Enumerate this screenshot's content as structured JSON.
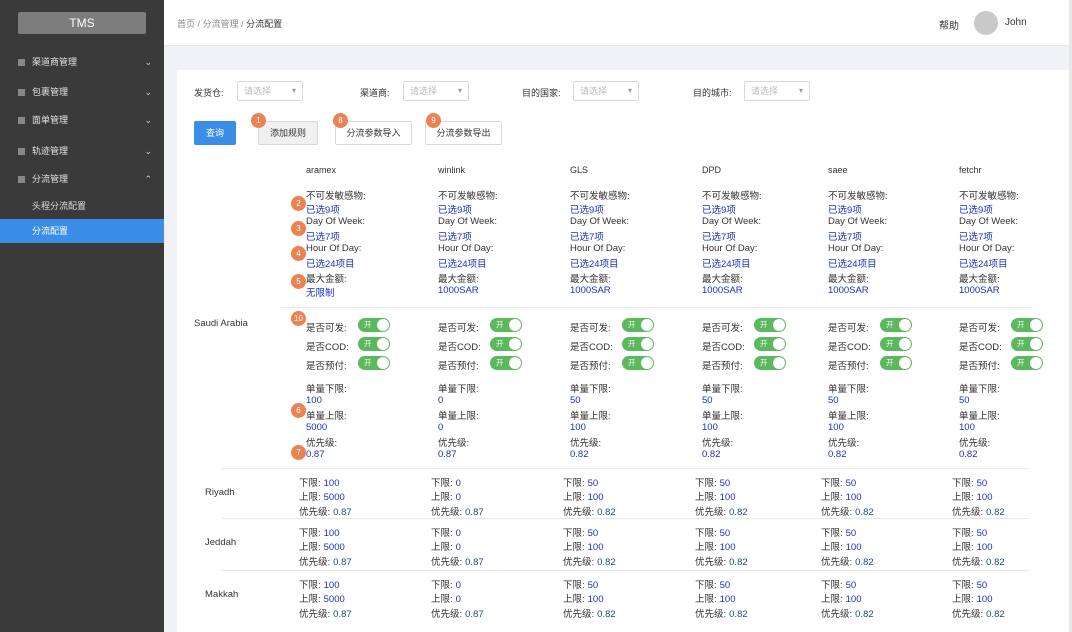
{
  "sidebar": {
    "logo": "TMS",
    "menu": [
      {
        "label": "渠道商管理",
        "chevron": "⌄"
      },
      {
        "label": "包裹管理",
        "chevron": "⌄"
      },
      {
        "label": "面单管理",
        "chevron": "⌄"
      },
      {
        "label": "轨迹管理",
        "chevron": "⌄"
      },
      {
        "label": "分流管理",
        "chevron": "⌃"
      }
    ],
    "submenu": [
      {
        "label": "头程分流配置"
      },
      {
        "label": "分流配置"
      }
    ]
  },
  "header": {
    "breadcrumb": [
      "首页",
      "分流管理",
      "分流配置"
    ],
    "sep": " / ",
    "help": "帮助",
    "user": "John"
  },
  "filters": [
    {
      "label": "发货仓:",
      "placeholder": "请选择"
    },
    {
      "label": "渠道商:",
      "placeholder": "请选择"
    },
    {
      "label": "目的国家:",
      "placeholder": "请选择"
    },
    {
      "label": "目的城市:",
      "placeholder": "请选择"
    }
  ],
  "buttons": {
    "query": "查询",
    "add_rule": "添加规则",
    "import": "分流参数导入",
    "export": "分流参数导出"
  },
  "badges": [
    "1",
    "8",
    "9",
    "2",
    "3",
    "4",
    "5",
    "10",
    "6",
    "7"
  ],
  "labels": {
    "sensitive": "不可发敏感物:",
    "dow": "Day Of Week:",
    "hod": "Hour Of Day:",
    "max_amount": "最大金额:",
    "can_ship": "是否可发:",
    "cod": "是否COD:",
    "prepay": "是否预付:",
    "min_qty": "单量下限:",
    "max_qty": "单量上限:",
    "priority": "优先级:",
    "lower": "下限:",
    "upper": "上限:",
    "city_priority": "优先级:",
    "toggle_on": "开"
  },
  "carriers": [
    {
      "name": "aramex",
      "sensitive": "已选9项",
      "dow": "已选7项",
      "hod": "已选24项目",
      "max_amount": "无限制",
      "min_qty": "100",
      "max_qty": "5000",
      "priority": "0.87"
    },
    {
      "name": "winlink",
      "sensitive": "已选9项",
      "dow": "已选7项",
      "hod": "已选24项目",
      "max_amount": "1000SAR",
      "min_qty": "0",
      "max_qty": "0",
      "priority": "0.87"
    },
    {
      "name": "GLS",
      "sensitive": "已选9项",
      "dow": "已选7项",
      "hod": "已选24项目",
      "max_amount": "1000SAR",
      "min_qty": "50",
      "max_qty": "100",
      "priority": "0.82"
    },
    {
      "name": "DPD",
      "sensitive": "已选9项",
      "dow": "已选7项",
      "hod": "已选24项目",
      "max_amount": "1000SAR",
      "min_qty": "50",
      "max_qty": "100",
      "priority": "0.82"
    },
    {
      "name": "saee",
      "sensitive": "已选9项",
      "dow": "已选7项",
      "hod": "已选24项目",
      "max_amount": "1000SAR",
      "min_qty": "50",
      "max_qty": "100",
      "priority": "0.82"
    },
    {
      "name": "fetchr",
      "sensitive": "已选9项",
      "dow": "已选7项",
      "hod": "已选24项目",
      "max_amount": "1000SAR",
      "min_qty": "50",
      "max_qty": "100",
      "priority": "0.82"
    }
  ],
  "country": "Saudi Arabia",
  "cities": [
    {
      "name": "Riyadh",
      "values": [
        [
          "100",
          "5000",
          "0.87"
        ],
        [
          "0",
          "0",
          "0.87"
        ],
        [
          "50",
          "100",
          "0.82"
        ],
        [
          "50",
          "100",
          "0.82"
        ],
        [
          "50",
          "100",
          "0.82"
        ],
        [
          "50",
          "100",
          "0.82"
        ]
      ]
    },
    {
      "name": "Jeddah",
      "values": [
        [
          "100",
          "5000",
          "0.87"
        ],
        [
          "0",
          "0",
          "0.87"
        ],
        [
          "50",
          "100",
          "0.82"
        ],
        [
          "50",
          "100",
          "0.82"
        ],
        [
          "50",
          "100",
          "0.82"
        ],
        [
          "50",
          "100",
          "0.82"
        ]
      ]
    },
    {
      "name": "Makkah",
      "values": [
        [
          "100",
          "5000",
          "0.87"
        ],
        [
          "0",
          "0",
          "0.87"
        ],
        [
          "50",
          "100",
          "0.82"
        ],
        [
          "50",
          "100",
          "0.82"
        ],
        [
          "50",
          "100",
          "0.82"
        ],
        [
          "50",
          "100",
          "0.82"
        ]
      ]
    }
  ],
  "colors": {
    "accent": "#3b8ee8",
    "toggle": "#5cb85c",
    "badge": "#ec8252",
    "value": "#1a2fc4"
  }
}
